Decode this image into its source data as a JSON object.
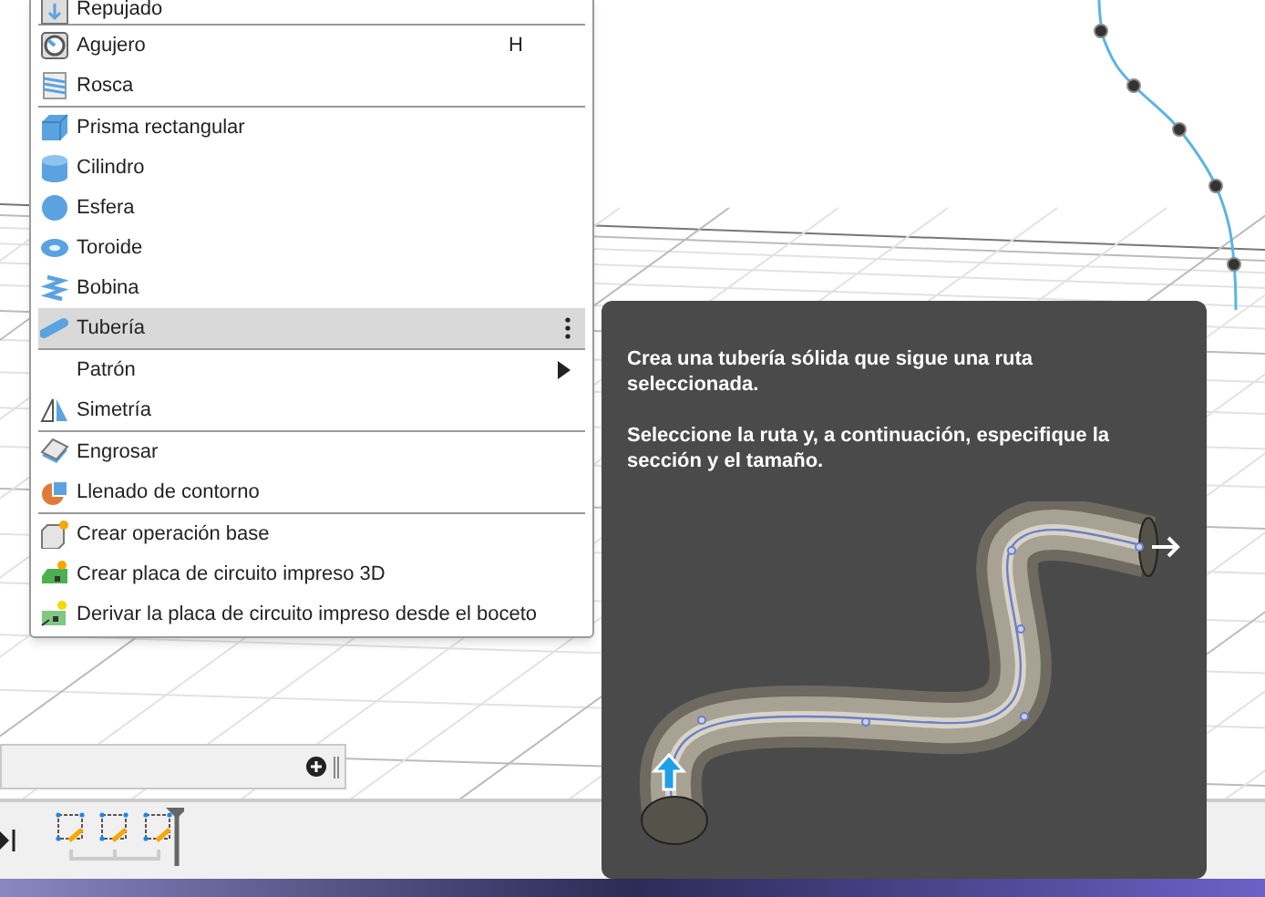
{
  "menu": {
    "groups": [
      [
        {
          "label": "Repujado",
          "selected": false,
          "submenu": false
        }
      ],
      [
        {
          "label": "Agujero",
          "shortcut": "H",
          "selected": false,
          "submenu": false
        },
        {
          "label": "Rosca",
          "selected": false,
          "submenu": false
        }
      ],
      [
        {
          "label": "Prisma rectangular",
          "selected": false,
          "submenu": false
        },
        {
          "label": "Cilindro",
          "selected": false,
          "submenu": false
        },
        {
          "label": "Esfera",
          "selected": false,
          "submenu": false
        },
        {
          "label": "Toroide",
          "selected": false,
          "submenu": false
        },
        {
          "label": "Bobina",
          "selected": false,
          "submenu": false
        },
        {
          "label": "Tubería",
          "selected": true,
          "submenu": false
        }
      ],
      [
        {
          "label": "Patrón",
          "selected": false,
          "submenu": true
        },
        {
          "label": "Simetría",
          "selected": false,
          "submenu": false
        }
      ],
      [
        {
          "label": "Engrosar",
          "selected": false,
          "submenu": false
        },
        {
          "label": "Llenado de contorno",
          "selected": false,
          "submenu": false
        }
      ],
      [
        {
          "label": "Crear operación base",
          "selected": false,
          "submenu": false
        },
        {
          "label": "Crear placa de circuito impreso 3D",
          "selected": false,
          "submenu": false
        },
        {
          "label": "Derivar la placa de circuito impreso desde el boceto",
          "selected": false,
          "submenu": false
        }
      ]
    ]
  },
  "tooltip": {
    "paragraphs": [
      "Crea una tubería sólida que sigue una ruta seleccionada.",
      "Seleccione la ruta y, a continuación, especifique la sección y el tamaño."
    ]
  }
}
